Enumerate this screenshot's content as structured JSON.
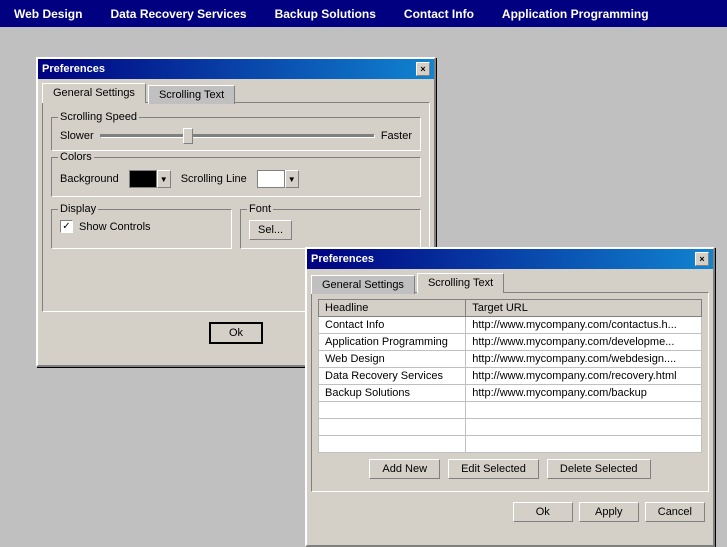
{
  "menubar": {
    "items": [
      {
        "label": "Web Design",
        "id": "web-design"
      },
      {
        "label": "Data Recovery Services",
        "id": "data-recovery"
      },
      {
        "label": "Backup Solutions",
        "id": "backup-solutions"
      },
      {
        "label": "Contact Info",
        "id": "contact-info"
      },
      {
        "label": "Application Programming",
        "id": "app-programming"
      }
    ]
  },
  "window1": {
    "title": "Preferences",
    "close_label": "×",
    "tabs": [
      {
        "label": "General Settings",
        "id": "general",
        "active": true
      },
      {
        "label": "Scrolling Text",
        "id": "scrolling",
        "active": false
      }
    ],
    "scrolling_speed": {
      "group_label": "Scrolling Speed",
      "slower_label": "Slower",
      "faster_label": "Faster"
    },
    "colors": {
      "group_label": "Colors",
      "background_label": "Background",
      "scrolling_line_label": "Scrolling Line"
    },
    "display": {
      "group_label": "Display",
      "show_controls_label": "Show Controls",
      "checked": true
    },
    "font": {
      "group_label": "Font",
      "select_label": "Sel..."
    },
    "ok_label": "Ok"
  },
  "window2": {
    "title": "Preferences",
    "close_label": "×",
    "tabs": [
      {
        "label": "General Settings",
        "id": "general2",
        "active": false
      },
      {
        "label": "Scrolling Text",
        "id": "scrolling2",
        "active": true
      }
    ],
    "table": {
      "columns": [
        "Headline",
        "Target URL"
      ],
      "rows": [
        {
          "headline": "Contact Info",
          "url": "http://www.mycompany.com/contactus.h..."
        },
        {
          "headline": "Application Programming",
          "url": "http://www.mycompany.com/developme..."
        },
        {
          "headline": "Web Design",
          "url": "http://www.mycompany.com/webdesign...."
        },
        {
          "headline": "Data Recovery Services",
          "url": "http://www.mycompany.com/recovery.html"
        },
        {
          "headline": "Backup Solutions",
          "url": "http://www.mycompany.com/backup"
        }
      ]
    },
    "add_new_label": "Add New",
    "edit_selected_label": "Edit Selected",
    "delete_selected_label": "Delete Selected",
    "ok_label": "Ok",
    "apply_label": "Apply",
    "cancel_label": "Cancel"
  }
}
